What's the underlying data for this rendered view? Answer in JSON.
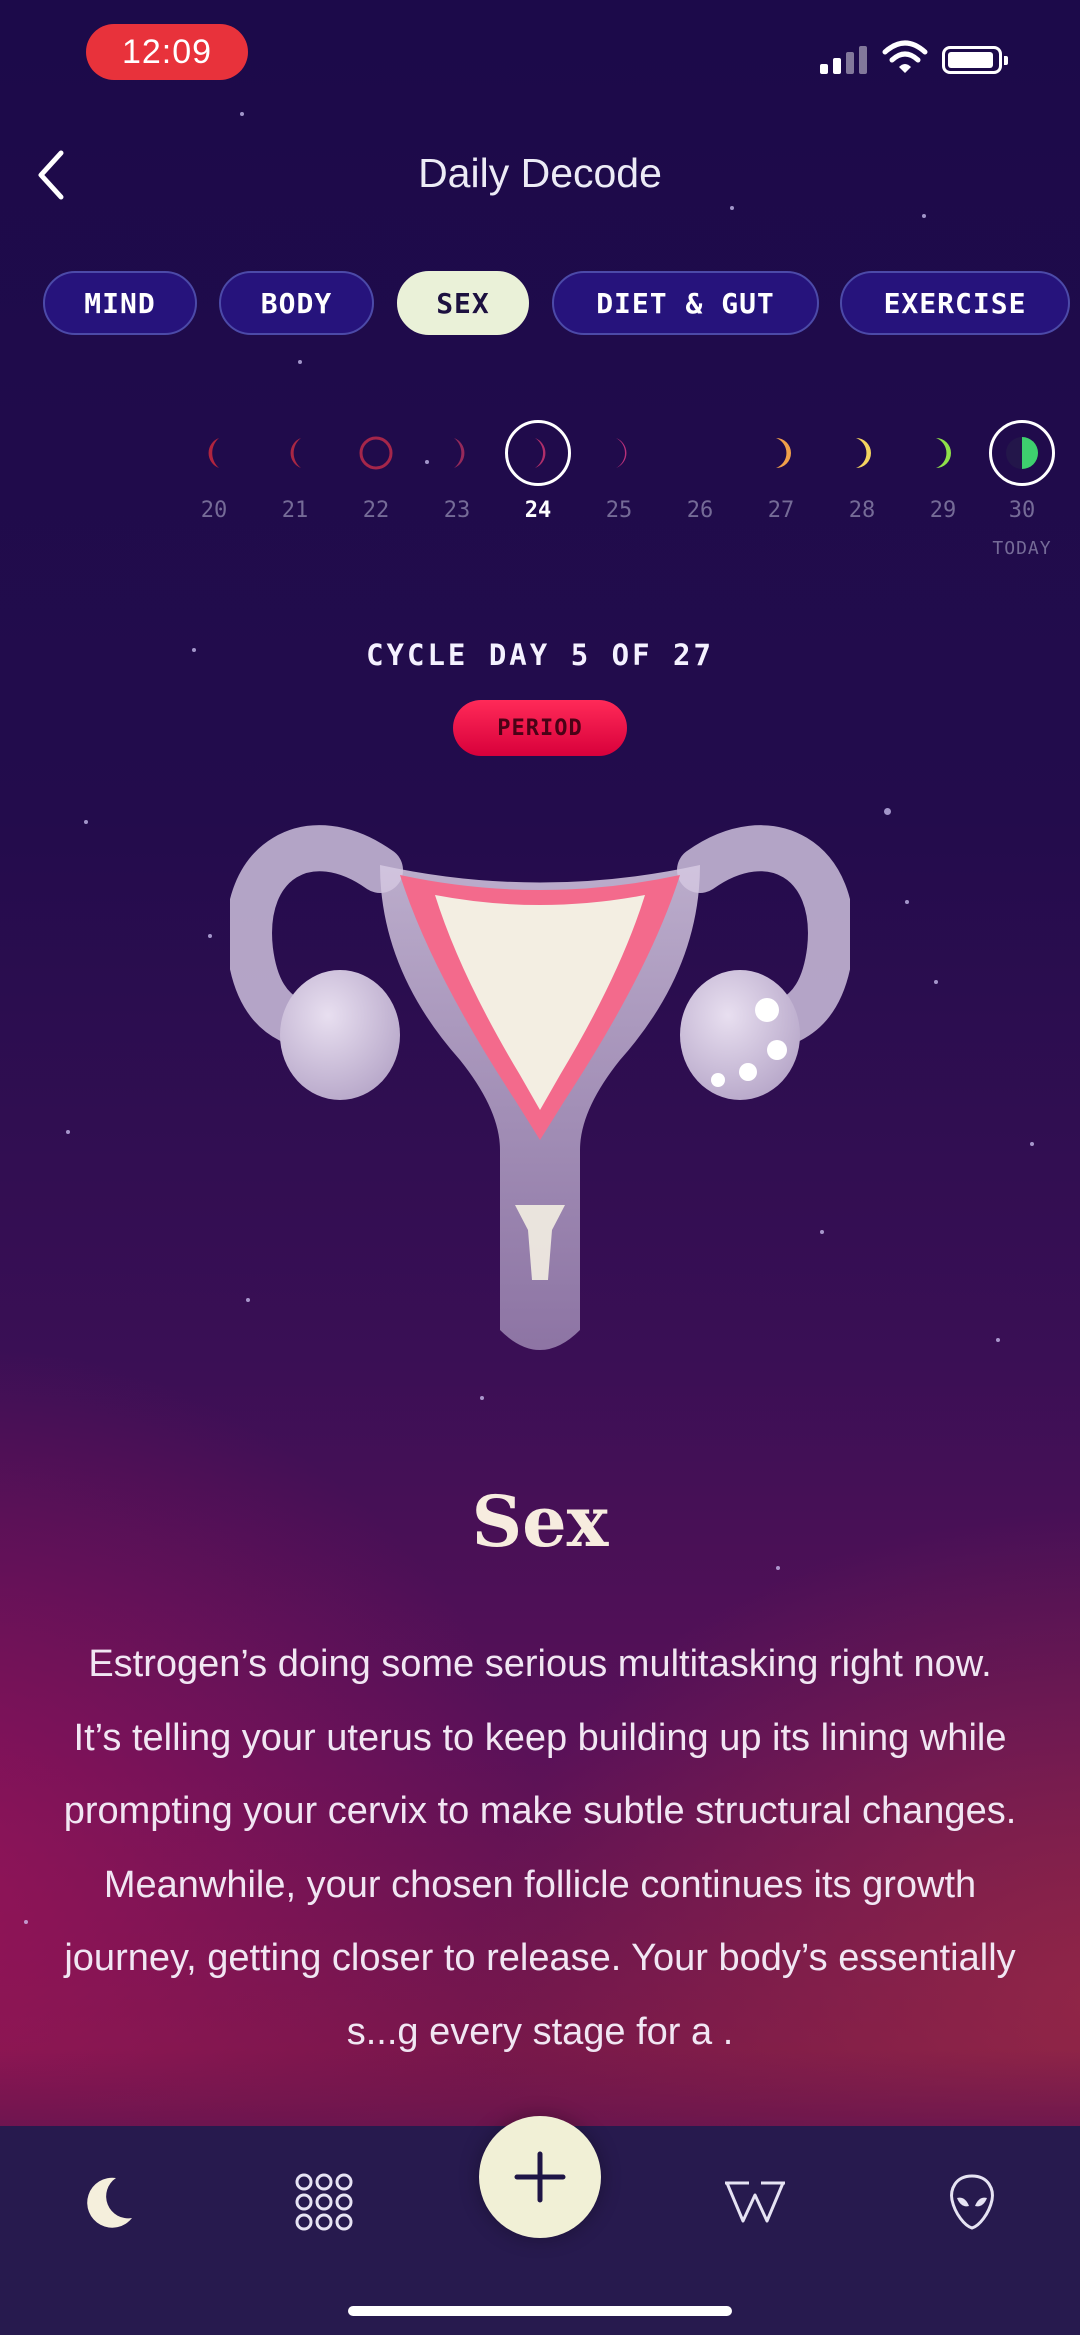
{
  "status_bar": {
    "time": "12:09"
  },
  "header": {
    "title": "Daily Decode"
  },
  "tabs": [
    {
      "label": "MIND",
      "active": false
    },
    {
      "label": "BODY",
      "active": false
    },
    {
      "label": "SEX",
      "active": true
    },
    {
      "label": "DIET & GUT",
      "active": false
    },
    {
      "label": "EXERCISE",
      "active": false
    }
  ],
  "days": [
    {
      "num": "20",
      "phase": "thin-waning-crescent",
      "color": "#b0243e"
    },
    {
      "num": "21",
      "phase": "thin-waning-crescent",
      "color": "#a82744"
    },
    {
      "num": "22",
      "phase": "new-moon-outline",
      "color": "#a5264a"
    },
    {
      "num": "23",
      "phase": "thin-waxing-crescent",
      "color": "#96295a"
    },
    {
      "num": "24",
      "phase": "thin-waxing-crescent",
      "color": "#b02e6a",
      "selected": true
    },
    {
      "num": "25",
      "phase": "waxing-crescent",
      "color": "#b8307a"
    },
    {
      "num": "26",
      "phase": "waxing-crescent",
      "color": "#e06a5a"
    },
    {
      "num": "27",
      "phase": "waxing-crescent",
      "color": "#f0a04a"
    },
    {
      "num": "28",
      "phase": "waxing-crescent",
      "color": "#f4d460"
    },
    {
      "num": "29",
      "phase": "waxing-crescent",
      "color": "#8fe04a"
    },
    {
      "num": "30",
      "phase": "half-moon",
      "color": "#3ecf6e",
      "today": true
    }
  ],
  "today_label": "TODAY",
  "cycle": {
    "day_text": "CYCLE DAY 5 OF 27",
    "phase_badge": "PERIOD",
    "badge_color": "#ff1f4f"
  },
  "section": {
    "title": "Sex",
    "body": "Estrogen’s doing some serious multitasking right now. It’s telling your uterus to keep building up its lining while prompting your cervix to make subtle structural changes. Meanwhile, your chosen follicle continues its growth journey, getting closer to release. Your body’s essentially s...g every stage for a ."
  },
  "bottom_nav": [
    {
      "name": "moon-icon"
    },
    {
      "name": "grid-icon"
    },
    {
      "name": "plus-icon"
    },
    {
      "name": "witch-w-icon"
    },
    {
      "name": "alien-icon"
    }
  ]
}
